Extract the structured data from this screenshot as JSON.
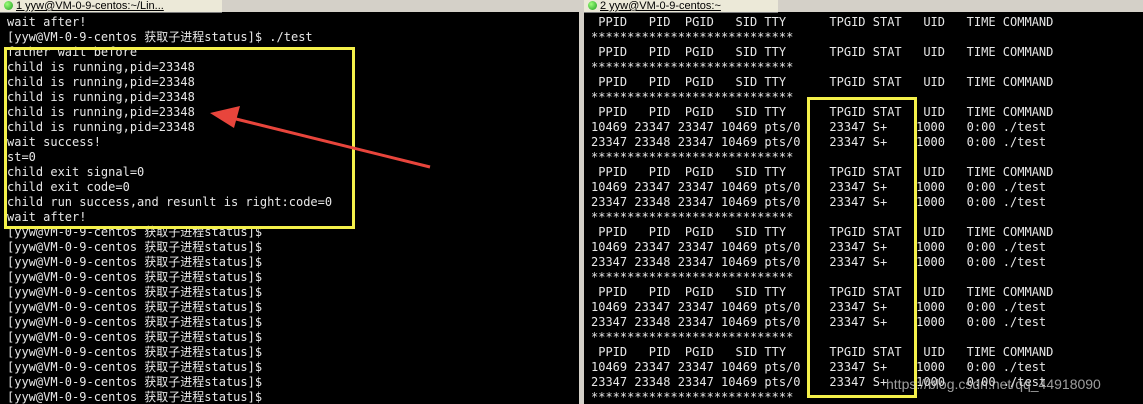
{
  "tabs": {
    "left": "1 yyw@VM-0-9-centos:~/Lin...",
    "right": "2 yyw@VM-0-9-centos:~"
  },
  "left_terminal": [
    "wait after!",
    "[yyw@VM-0-9-centos 获取子进程status]$ ./test",
    "father wait before",
    "child is running,pid=23348",
    "child is running,pid=23348",
    "child is running,pid=23348",
    "child is running,pid=23348",
    "child is running,pid=23348",
    "wait success!",
    "st=0",
    "child exit signal=0",
    "child exit code=0",
    "child run success,and resunlt is right:code=0",
    "wait after!",
    "[yyw@VM-0-9-centos 获取子进程status]$",
    "[yyw@VM-0-9-centos 获取子进程status]$",
    "[yyw@VM-0-9-centos 获取子进程status]$",
    "[yyw@VM-0-9-centos 获取子进程status]$",
    "[yyw@VM-0-9-centos 获取子进程status]$",
    "[yyw@VM-0-9-centos 获取子进程status]$",
    "[yyw@VM-0-9-centos 获取子进程status]$",
    "[yyw@VM-0-9-centos 获取子进程status]$",
    "[yyw@VM-0-9-centos 获取子进程status]$",
    "[yyw@VM-0-9-centos 获取子进程status]$",
    "[yyw@VM-0-9-centos 获取子进程status]$",
    "[yyw@VM-0-9-centos 获取子进程status]$"
  ],
  "right_terminal": [
    " PPID   PID  PGID   SID TTY      TPGID STAT   UID   TIME COMMAND",
    "****************************",
    " PPID   PID  PGID   SID TTY      TPGID STAT   UID   TIME COMMAND",
    "****************************",
    " PPID   PID  PGID   SID TTY      TPGID STAT   UID   TIME COMMAND",
    "****************************",
    " PPID   PID  PGID   SID TTY      TPGID STAT   UID   TIME COMMAND",
    "10469 23347 23347 10469 pts/0    23347 S+    1000   0:00 ./test",
    "23347 23348 23347 10469 pts/0    23347 S+    1000   0:00 ./test",
    "****************************",
    " PPID   PID  PGID   SID TTY      TPGID STAT   UID   TIME COMMAND",
    "10469 23347 23347 10469 pts/0    23347 S+    1000   0:00 ./test",
    "23347 23348 23347 10469 pts/0    23347 S+    1000   0:00 ./test",
    "****************************",
    " PPID   PID  PGID   SID TTY      TPGID STAT   UID   TIME COMMAND",
    "10469 23347 23347 10469 pts/0    23347 S+    1000   0:00 ./test",
    "23347 23348 23347 10469 pts/0    23347 S+    1000   0:00 ./test",
    "****************************",
    " PPID   PID  PGID   SID TTY      TPGID STAT   UID   TIME COMMAND",
    "10469 23347 23347 10469 pts/0    23347 S+    1000   0:00 ./test",
    "23347 23348 23347 10469 pts/0    23347 S+    1000   0:00 ./test",
    "****************************",
    " PPID   PID  PGID   SID TTY      TPGID STAT   UID   TIME COMMAND",
    "10469 23347 23347 10469 pts/0    23347 S+    1000   0:00 ./test",
    "23347 23348 23347 10469 pts/0    23347 S+    1000   0:00 ./test",
    "****************************"
  ],
  "watermark": "https://blog.csdn.net/qq_44918090",
  "colors": {
    "terminal_bg": "#000000",
    "terminal_fg": "#e8e8e8",
    "highlight_box": "#f4f04a",
    "arrow": "#e8453c"
  }
}
